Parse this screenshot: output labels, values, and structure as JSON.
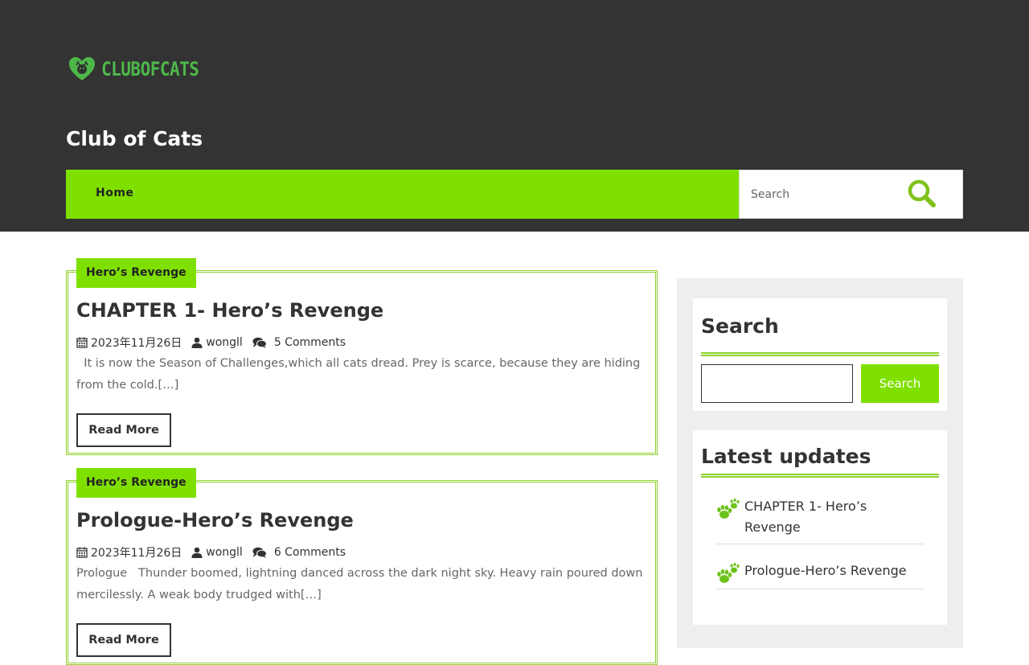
{
  "header": {
    "logo_text": "CLUBOFCATS",
    "site_title": "Club of Cats",
    "nav": [
      {
        "label": "Home"
      }
    ],
    "search": {
      "placeholder": "Search"
    }
  },
  "posts": [
    {
      "category": "Hero’s Revenge",
      "title": "CHAPTER 1- Hero’s Revenge",
      "date": "2023年11月26日",
      "author": "wongll",
      "comments": "5 Comments",
      "excerpt": "  It is now the Season of Challenges,which all cats dread. Prey is scarce, because they are hiding from the cold.[…]",
      "read_more": "Read More"
    },
    {
      "category": "Hero’s Revenge",
      "title": "Prologue-Hero’s Revenge",
      "date": "2023年11月26日",
      "author": "wongll",
      "comments": "6 Comments",
      "excerpt": "Prologue   Thunder boomed, lightning danced across the dark night sky. Heavy rain poured down mercilessly. A weak body trudged with[…]",
      "read_more": "Read More"
    }
  ],
  "sidebar": {
    "search_widget": {
      "title": "Search",
      "button": "Search"
    },
    "latest_widget": {
      "title": "Latest updates",
      "items": [
        {
          "label": "CHAPTER 1- Hero’s Revenge"
        },
        {
          "label": "Prologue-Hero’s Revenge"
        }
      ]
    }
  },
  "colors": {
    "header_bg": "#333333",
    "accent_green": "#7fe000",
    "logo_green": "#4db84a",
    "border_green": "#8fd12a",
    "sidebar_bg": "#eeeeee"
  },
  "icons": {
    "logo": "cat-heart-icon",
    "search": "search-magnifier-icon",
    "date": "calendar-icon",
    "author": "user-icon",
    "comments": "comments-icon",
    "list_bullet": "paw-icon"
  }
}
